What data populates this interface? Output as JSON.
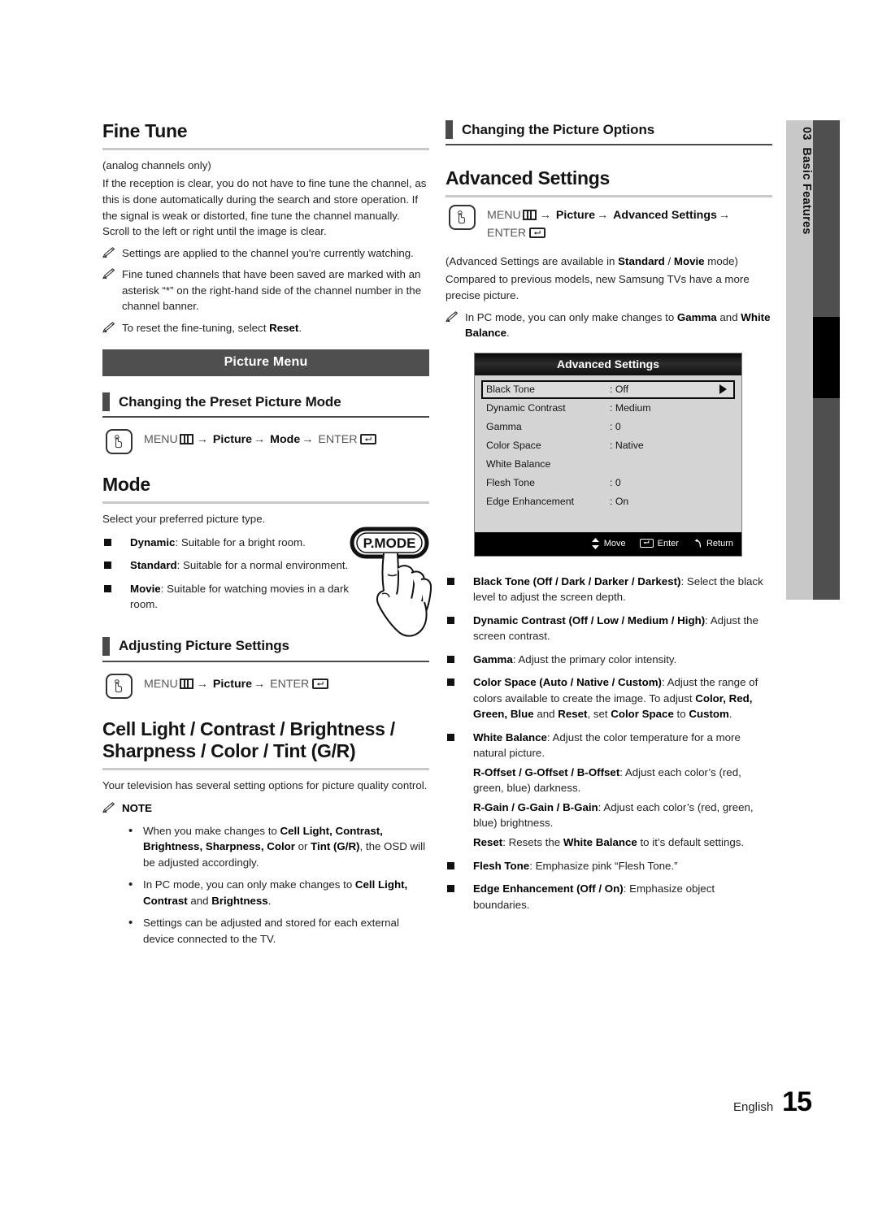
{
  "page": {
    "language_label": "English",
    "page_number": "15",
    "chapter_number": "03",
    "chapter_title": "Basic Features"
  },
  "left_column": {
    "fine_tune": {
      "heading": "Fine Tune",
      "subtitle": "(analog channels only)",
      "body": "If the reception is clear, you do not have to fine tune the channel, as this is done automatically during the search and store operation. If the signal is weak or distorted, fine tune the channel manually. Scroll to the left or right until the image is clear.",
      "notes": [
        "Settings are applied to the channel you're currently watching.",
        "Fine tuned channels that have been saved are marked with an asterisk “*” on the right-hand side of the channel number in the channel banner.",
        "To reset the fine-tuning, select Reset."
      ]
    },
    "picture_menu_banner": "Picture Menu",
    "preset_picture_mode": {
      "heading": "Changing the Preset Picture Mode",
      "path": {
        "menu": "MENU",
        "steps": [
          "Picture",
          "Mode"
        ],
        "enter": "ENTER"
      }
    },
    "mode": {
      "heading": "Mode",
      "intro": "Select your preferred picture type.",
      "items": [
        {
          "term": "Dynamic",
          "desc": ": Suitable for a bright room."
        },
        {
          "term": "Standard",
          "desc": ": Suitable for a normal environment."
        },
        {
          "term": "Movie",
          "desc": ": Suitable for watching movies in a dark room."
        }
      ],
      "remote_button_label": "P.MODE"
    },
    "adjusting_picture_settings": {
      "heading": "Adjusting Picture Settings",
      "path": {
        "menu": "MENU",
        "steps": [
          "Picture"
        ],
        "enter": "ENTER"
      }
    },
    "cell_light": {
      "heading_line1": "Cell Light / Contrast / Brightness /",
      "heading_line2": "Sharpness / Color / Tint (G/R)",
      "body": "Your television has several setting options for picture quality control.",
      "note_label": "NOTE",
      "note_items": [
        "When you make changes to Cell Light, Contrast, Brightness, Sharpness, Color or Tint (G/R), the OSD will be adjusted accordingly.",
        "In PC mode, you can only make changes to Cell Light, Contrast and Brightness.",
        "Settings can be adjusted and stored for each external device connected to the TV."
      ]
    }
  },
  "right_column": {
    "picture_options": {
      "heading": "Changing the Picture Options"
    },
    "advanced_settings": {
      "heading": "Advanced Settings",
      "path": {
        "menu": "MENU",
        "steps": [
          "Picture",
          "Advanced Settings"
        ],
        "enter": "ENTER"
      },
      "availability": "(Advanced Settings are available in Standard / Movie mode)",
      "body": "Compared to previous models, new Samsung TVs have a more precise picture.",
      "note": "In PC mode, you can only make changes to Gamma and White Balance."
    },
    "osd": {
      "title": "Advanced Settings",
      "rows": [
        {
          "label": "Black Tone",
          "value": ": Off",
          "selected": true
        },
        {
          "label": "Dynamic Contrast",
          "value": ": Medium",
          "selected": false
        },
        {
          "label": "Gamma",
          "value": ": 0",
          "selected": false
        },
        {
          "label": "Color Space",
          "value": ": Native",
          "selected": false
        },
        {
          "label": "White Balance",
          "value": "",
          "selected": false
        },
        {
          "label": "Flesh Tone",
          "value": ": 0",
          "selected": false
        },
        {
          "label": "Edge Enhancement",
          "value": ": On",
          "selected": false
        }
      ],
      "footer": {
        "move": "Move",
        "enter": "Enter",
        "return": "Return"
      }
    },
    "option_items": [
      {
        "term": "Black Tone (Off / Dark / Darker / Darkest)",
        "desc": ": Select the black level to adjust the screen depth."
      },
      {
        "term": "Dynamic Contrast (Off / Low / Medium / High)",
        "desc": ": Adjust the screen contrast."
      },
      {
        "term": "Gamma",
        "desc": ": Adjust the primary color intensity."
      },
      {
        "term": "Color Space (Auto / Native / Custom)",
        "desc": ": Adjust the range of colors available to create the image. To adjust Color, Red, Green, Blue and Reset, set Color Space to Custom."
      },
      {
        "term": "White Balance",
        "desc": ": Adjust the color temperature for a more natural picture.",
        "subs": [
          {
            "term": "R-Offset / G-Offset / B-Offset",
            "desc": ": Adjust each color’s (red, green, blue) darkness."
          },
          {
            "term": "R-Gain / G-Gain / B-Gain",
            "desc": ": Adjust each color’s (red, green, blue) brightness."
          },
          {
            "term": "Reset",
            "desc": ": Resets the White Balance to it’s default settings."
          }
        ]
      },
      {
        "term": "Flesh Tone",
        "desc": ": Emphasize pink “Flesh Tone.”"
      },
      {
        "term": "Edge Enhancement (Off / On)",
        "desc": ": Emphasize object boundaries."
      }
    ]
  }
}
